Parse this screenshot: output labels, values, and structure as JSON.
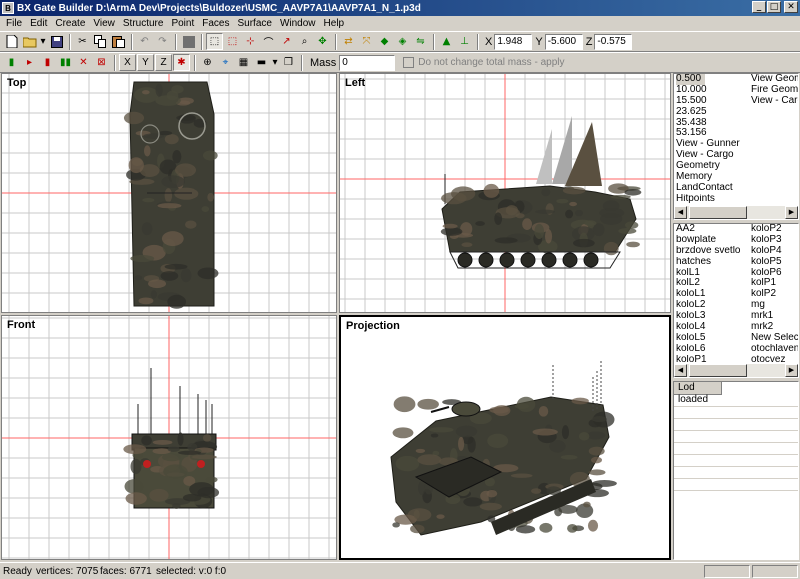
{
  "window": {
    "title": "BX Gate Builder  D:\\ArmA Dev\\Projects\\Buldozer\\USMC_AAVP7A1\\AAVP7A1_N_1.p3d",
    "minimize": "_",
    "maximize": "□",
    "close": "✕"
  },
  "menu": [
    "File",
    "Edit",
    "Create",
    "View",
    "Structure",
    "Point",
    "Faces",
    "Surface",
    "Window",
    "Help"
  ],
  "coords": {
    "x_label": "X",
    "x_value": "1.948",
    "y_label": "Y",
    "y_value": "-5.600",
    "z_label": "Z",
    "z_value": "-0.575"
  },
  "axis_buttons": [
    "X",
    "Y",
    "Z"
  ],
  "mass": {
    "label": "Mass",
    "value": "0",
    "checkbox_label": "Do not change total mass - apply"
  },
  "viewports": {
    "top": "Top",
    "left": "Left",
    "front": "Front",
    "projection": "Projection"
  },
  "lod_list": {
    "col_a": [
      "0.500",
      "10.000",
      "15.500",
      "23.625",
      "35.438",
      "53.156",
      "View - Gunner",
      "View - Cargo",
      "Geometry",
      "Memory",
      "LandContact",
      "Hitpoints"
    ],
    "col_b": [
      "View Geometry",
      "Fire Geometry",
      "View - Cargo"
    ],
    "selected": "0.500"
  },
  "selections": {
    "col_a": [
      "AA2",
      "bowplate",
      "brzdove svetlo",
      "hatches",
      "kolL1",
      "kolL2",
      "koloL1",
      "koloL2",
      "koloL3",
      "koloL4",
      "koloL5",
      "koloL6",
      "koloP1"
    ],
    "col_b": [
      "koloP2",
      "koloP3",
      "koloP4",
      "koloP5",
      "koloP6",
      "kolP1",
      "kolP2",
      "mg",
      "mrk1",
      "mrk2",
      "New Selection",
      "otochlaven",
      "otocvez"
    ]
  },
  "info": {
    "header": "Lod loaded"
  },
  "status": {
    "ready": "Ready",
    "vertices": "vertices: 7075",
    "faces": "faces: 6771",
    "selected": "selected: v:0 f:0"
  },
  "colors": {
    "title_start": "#0a246a",
    "title_end": "#3a6ea5",
    "axis_red": "#ff6666",
    "grid": "#c8c8c8",
    "face": "#d4d0c8"
  }
}
